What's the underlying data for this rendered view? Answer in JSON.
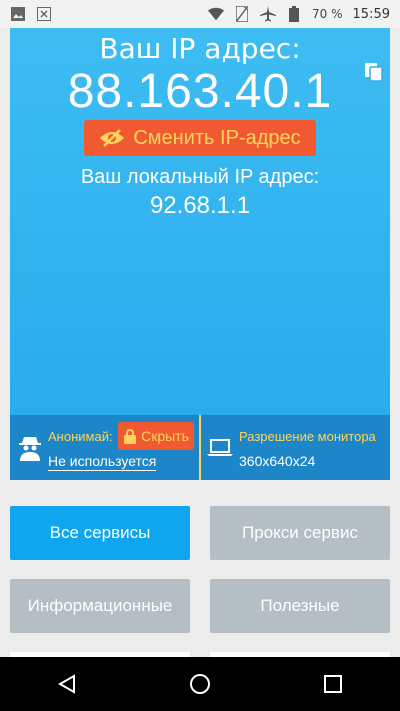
{
  "status_bar": {
    "battery": "70 %",
    "time": "15:59",
    "icons": [
      "image-icon",
      "close-box-icon",
      "wifi-icon",
      "no-sim-icon",
      "airplane-icon",
      "battery-icon"
    ]
  },
  "hero": {
    "title": "Ваш IP адрес:",
    "ip": "88.163.40.1",
    "change_button": "Сменить IP-адрес",
    "local_label": "Ваш локальный IP адрес:",
    "local_ip": "92.68.1.1"
  },
  "strip": {
    "anon_label": "Анонимай:",
    "hide_button": "Скрыть",
    "anon_value": "Не используется",
    "monitor_label": "Разрешение монитора",
    "monitor_value": "360x640x24"
  },
  "services": {
    "all": "Все сервисы",
    "proxy": "Прокси сервис",
    "info": "Информационные",
    "useful": "Полезные"
  },
  "colors": {
    "hero_top": "#3dbdf2",
    "accent_orange": "#f15a31",
    "accent_yellow": "#ffd35c",
    "strip_blue": "#1d86c9",
    "active_blue": "#0fa6ef",
    "inactive_gray": "#b4bec3"
  }
}
